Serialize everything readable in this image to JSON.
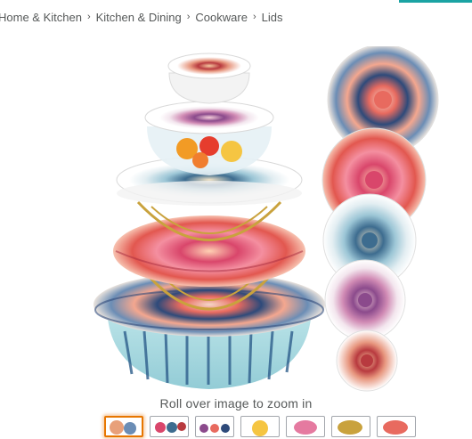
{
  "breadcrumb": {
    "items": [
      "Home & Kitchen",
      "Kitchen & Dining",
      "Cookware",
      "Lids"
    ],
    "separator": "›"
  },
  "image": {
    "alt": "Mandala print reusable bowl covers on stacked bowls and fabric circles",
    "zoom_hint": "Roll over image to zoom in"
  },
  "thumbnails": {
    "count": 7,
    "selected_index": 0
  },
  "colors": {
    "accent": "#1aa3a3",
    "selected_thumb": "#e77600",
    "coral": "#e86a5f",
    "navy": "#2e4a7a",
    "teal_bowl": "#a8dbe2",
    "pink": "#e57aa0"
  }
}
